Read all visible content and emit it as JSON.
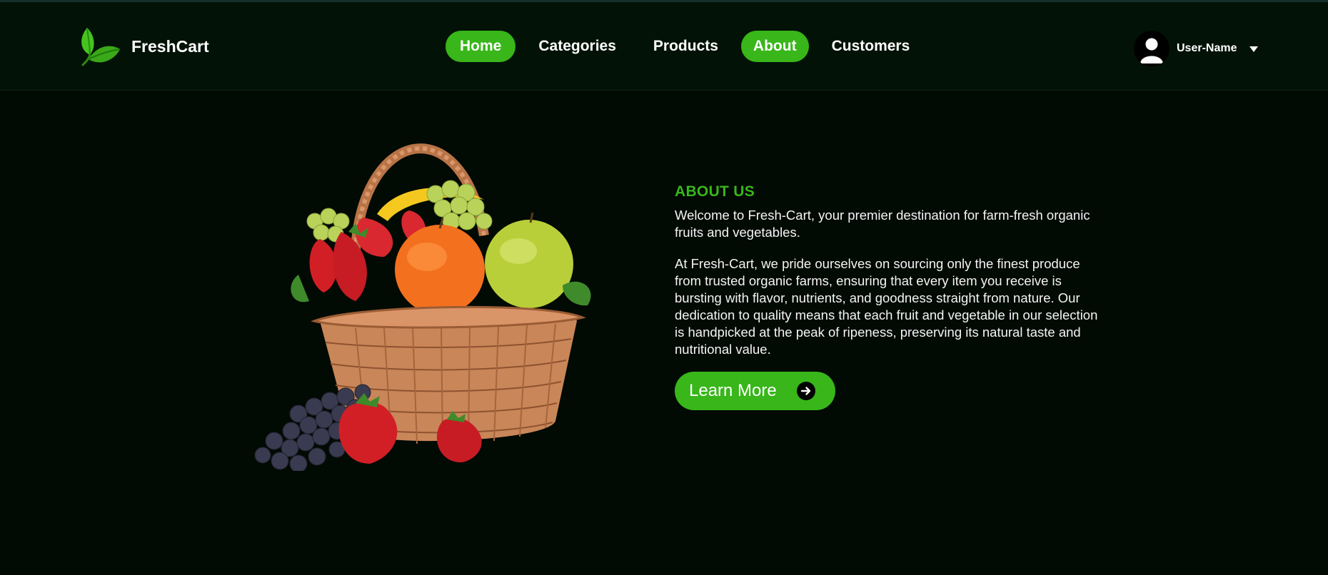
{
  "brand": {
    "name": "FreshCart",
    "logo_icon": "leaf-icon"
  },
  "nav": {
    "items": [
      {
        "label": "Home",
        "active": true
      },
      {
        "label": "Categories",
        "active": false
      },
      {
        "label": "Products",
        "active": false
      },
      {
        "label": "About",
        "active": true
      },
      {
        "label": "Customers",
        "active": false
      }
    ]
  },
  "user": {
    "name": "User-Name",
    "avatar_icon": "user-avatar-icon",
    "menu_icon": "caret-down-icon"
  },
  "about": {
    "label": "ABOUT US",
    "intro": "Welcome to Fresh-Cart, your premier destination for farm-fresh organic fruits and vegetables.",
    "body": "At Fresh-Cart, we pride ourselves on sourcing only the finest produce from trusted organic farms, ensuring that every item you receive is bursting with flavor, nutrients, and goodness straight from nature. Our dedication to quality means that each fruit and vegetable in our selection is handpicked at the peak of ripeness, preserving its natural taste and nutritional value.",
    "button_label": "Learn More",
    "button_icon": "arrow-right-circle-icon"
  },
  "hero_image": "fruit-basket-image",
  "colors": {
    "accent": "#38b61a",
    "background": "#020a04",
    "header": "#031207"
  }
}
